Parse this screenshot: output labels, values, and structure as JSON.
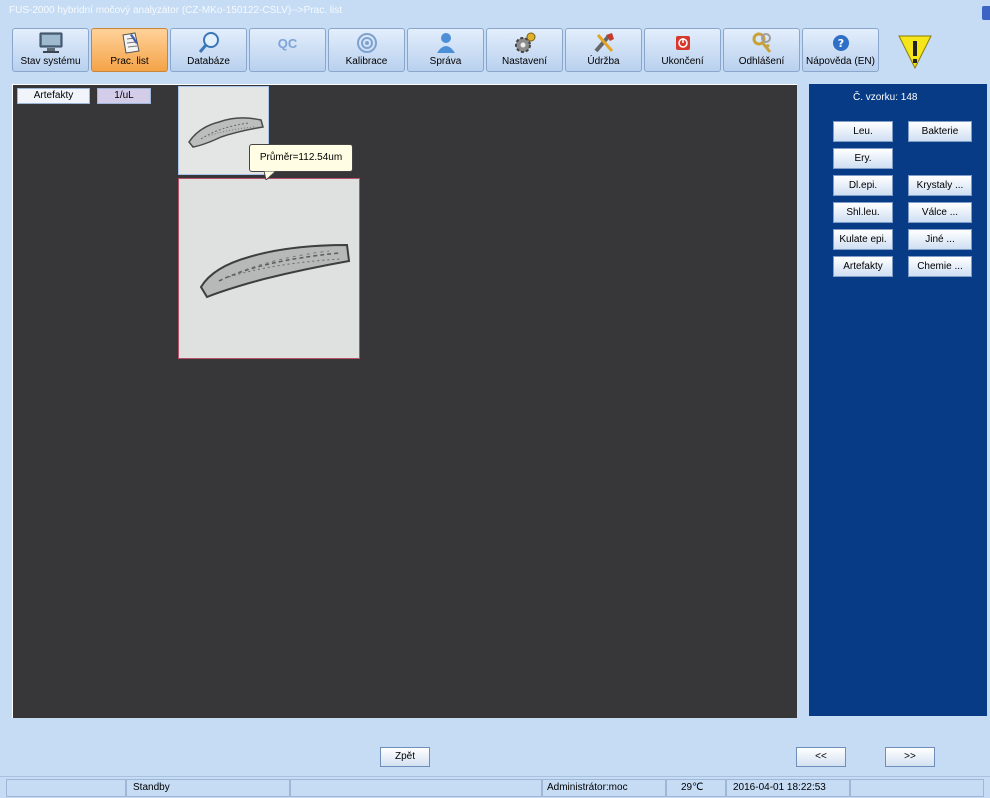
{
  "window": {
    "title": "FUS-2000 hybridní močový analyzátor (CZ-MKo-150122-CSLV)-->Prac. list"
  },
  "toolbar": {
    "buttons": [
      {
        "label": "Stav systému",
        "icon": "monitor-icon"
      },
      {
        "label": "Prac. list",
        "icon": "worklist-icon",
        "active": true
      },
      {
        "label": "Databáze",
        "icon": "magnifier-icon"
      },
      {
        "label": "",
        "icon": "qc-icon",
        "icon_text": "QC"
      },
      {
        "label": "Kalibrace",
        "icon": "target-icon"
      },
      {
        "label": "Správa",
        "icon": "user-icon"
      },
      {
        "label": "Nastavení",
        "icon": "gear-icon"
      },
      {
        "label": "Údržba",
        "icon": "tools-icon"
      },
      {
        "label": "Ukončení",
        "icon": "power-icon"
      },
      {
        "label": "Odhlášení",
        "icon": "key-icon"
      },
      {
        "label": "Nápověda (EN)",
        "icon": "help-icon"
      }
    ]
  },
  "viewer": {
    "category_chip": "Artefakty",
    "unit_chip": "1/uL",
    "tooltip": "Průměr=112.54um"
  },
  "side": {
    "sample_label": "Č. vzorku: 148",
    "left_buttons": [
      "Leu.",
      "Ery.",
      "Dl.epi.",
      "Shl.leu.",
      "Kulate epi.",
      "Artefakty"
    ],
    "right_buttons": [
      "Bakterie",
      "Krystaly ...",
      "Válce ...",
      "Jiné ...",
      "Chemie ..."
    ]
  },
  "footer": {
    "back_label": "Zpět",
    "prev_label": "<<",
    "next_label": ">>"
  },
  "status": {
    "state": "Standby",
    "user": "Administrátor:moc",
    "temperature": "29℃",
    "datetime": "2016-04-01 18:22:53"
  },
  "colors": {
    "accent_active": "#f4a347",
    "sidebar": "#073b86",
    "canvas": "#37373a",
    "warning": "#f5e51b"
  }
}
